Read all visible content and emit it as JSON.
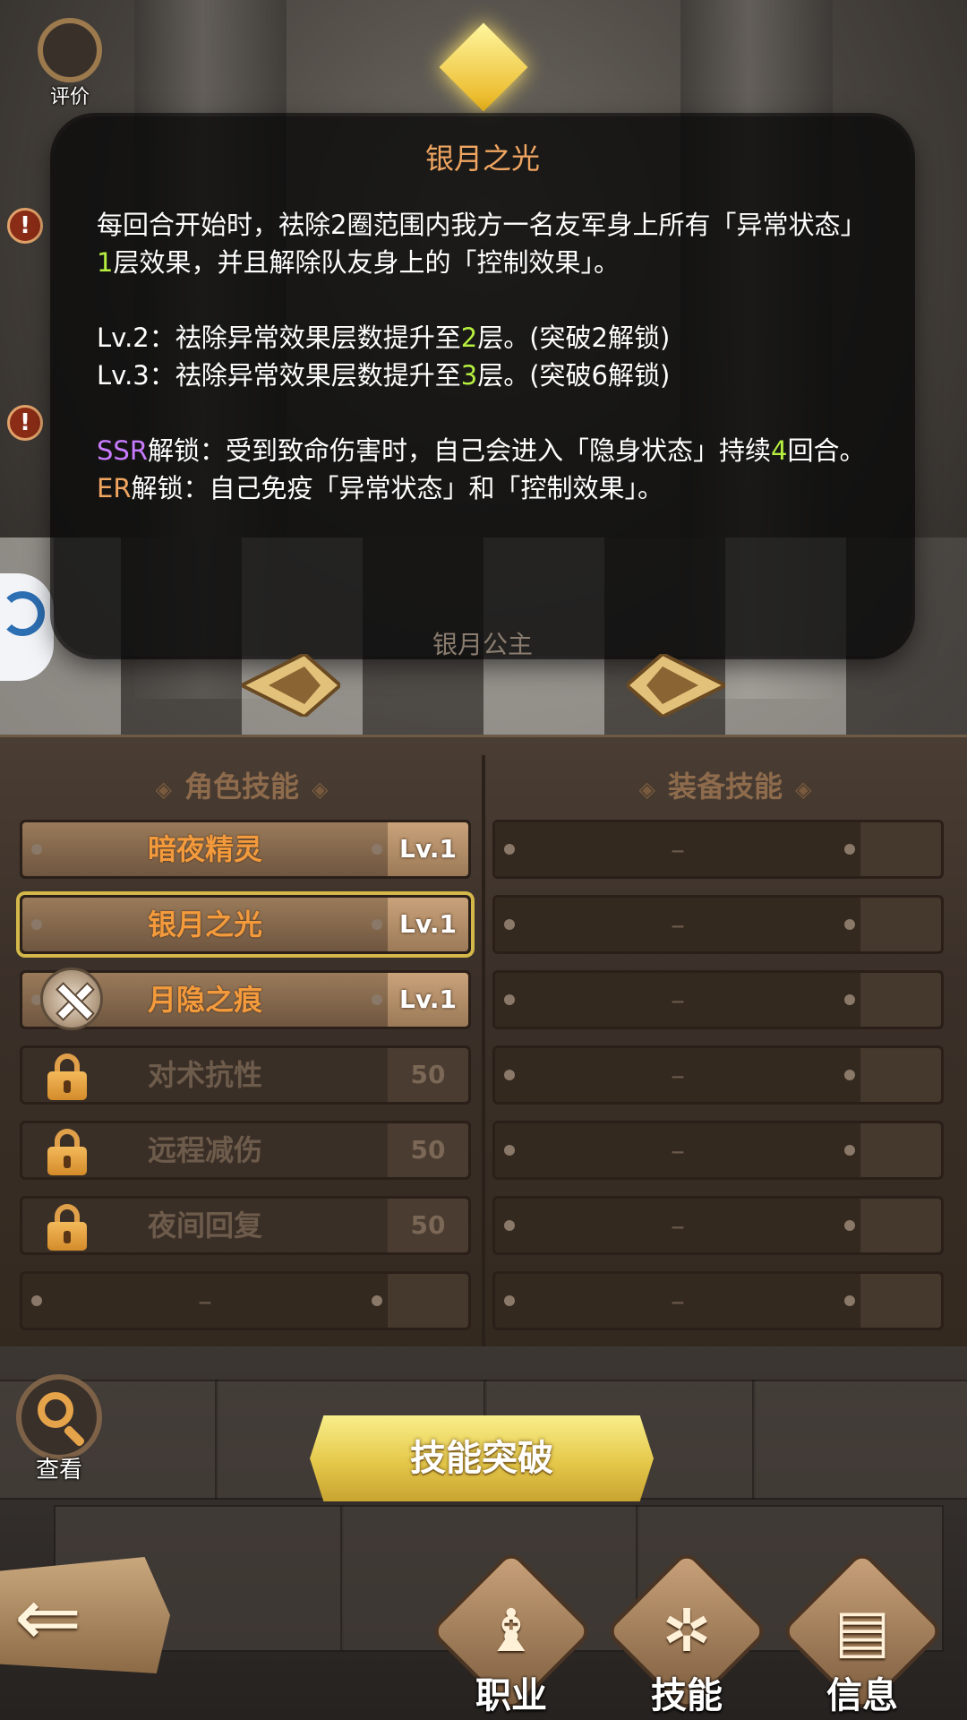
{
  "top": {
    "rate_label": "评价"
  },
  "tooltip": {
    "title": "银月之光",
    "desc_1": "每回合开始时，祛除2圈范围内我方一名友军身上所有「异常状态」",
    "desc_num": "1",
    "desc_2": "层效果，并且解除队友身上的「控制效果」。",
    "lv2_pre": "Lv.2：祛除异常效果层数提升至",
    "lv2_num": "2",
    "lv2_post": "层。(突破2解锁)",
    "lv3_pre": "Lv.3：祛除异常效果层数提升至",
    "lv3_num": "3",
    "lv3_post": "层。(突破6解锁)",
    "ssr_tag": "SSR",
    "ssr_pre": "解锁：受到致命伤害时，自己会进入「隐身状态」持续",
    "ssr_num": "4",
    "ssr_post": "回合。",
    "er_tag": "ER",
    "er_text": "解锁：自己免疫「异常状态」和「控制效果」。",
    "character_name": "银月公主"
  },
  "panel": {
    "left_title": "角色技能",
    "right_title": "装备技能",
    "role_skills": [
      {
        "name": "暗夜精灵",
        "level": "Lv.1",
        "state": "active"
      },
      {
        "name": "银月之光",
        "level": "Lv.1",
        "state": "selected"
      },
      {
        "name": "月隐之痕",
        "level": "Lv.1",
        "state": "active"
      },
      {
        "name": "对术抗性",
        "level": "50",
        "state": "locked"
      },
      {
        "name": "远程减伤",
        "level": "50",
        "state": "locked"
      },
      {
        "name": "夜间回复",
        "level": "50",
        "state": "locked"
      },
      {
        "name": "–",
        "level": "",
        "state": "empty"
      }
    ],
    "equip_skills": [
      "–",
      "–",
      "–",
      "–",
      "–",
      "–",
      "–"
    ]
  },
  "bottom": {
    "search_label": "查看",
    "breakthrough_label": "技能突破",
    "tabs": [
      {
        "label": "职业",
        "icon": "pawn-icon"
      },
      {
        "label": "技能",
        "icon": "skill-rune-icon"
      },
      {
        "label": "信息",
        "icon": "document-icon"
      }
    ]
  },
  "colors": {
    "tooltip_title": "#f0a561",
    "highlight_number": "#b6ef3f",
    "ssr": "#c87bff",
    "er": "#f0a561",
    "skill_active": "#f39a3c",
    "selected_border": "#d4b84a"
  }
}
